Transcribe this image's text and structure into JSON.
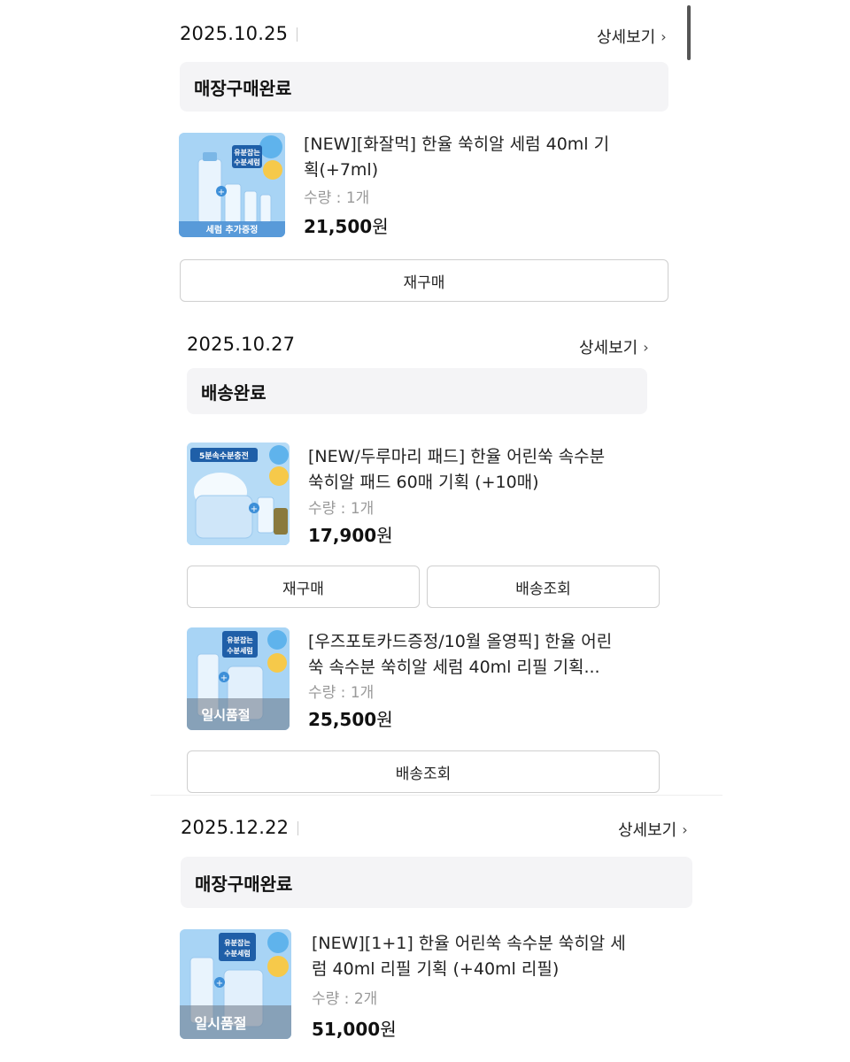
{
  "orders": [
    {
      "date": "2025.10.25",
      "detail_label": "상세보기",
      "status": "매장구매완료",
      "items": [
        {
          "name": "[NEW][화잘먹] 한율 쑥히알 세럼 40ml 기획(+7ml)",
          "qty": "수량 : 1개",
          "price": "21,500",
          "currency": "원",
          "thumb_badge": "유분잡는 수분세럼",
          "thumb_banner": "세럼 추가증정",
          "buttons": [
            "재구매"
          ]
        }
      ]
    },
    {
      "date": "2025.10.27",
      "detail_label": "상세보기",
      "status": "배송완료",
      "items": [
        {
          "name": "[NEW/두루마리 패드] 한율 어린쑥 속수분 쑥히알 패드 60매 기획 (+10매)",
          "qty": "수량 : 1개",
          "price": "17,900",
          "currency": "원",
          "thumb_badge": "5분속수분충전",
          "buttons": [
            "재구매",
            "배송조회"
          ]
        },
        {
          "name": "[우즈포토카드증정/10월 올영픽] 한율 어린쑥 속수분 쑥히알 세럼 40ml 리필 기획...",
          "qty": "수량 : 1개",
          "price": "25,500",
          "currency": "원",
          "thumb_badge": "유분잡는 수분세럼",
          "thumb_banner": "일시품절",
          "buttons": [
            "배송조회"
          ]
        }
      ]
    },
    {
      "date": "2025.12.22",
      "detail_label": "상세보기",
      "status": "매장구매완료",
      "items": [
        {
          "name": "[NEW][1+1] 한율 어린쑥 속수분 쑥히알 세럼 40ml 리필 기획 (+40ml 리필)",
          "qty": "수량 : 2개",
          "price": "51,000",
          "currency": "원",
          "thumb_badge": "유분잡는 수분세럼",
          "thumb_banner": "일시품절",
          "buttons": []
        }
      ]
    }
  ],
  "icons": {
    "chevron": "chevron-right-icon"
  }
}
